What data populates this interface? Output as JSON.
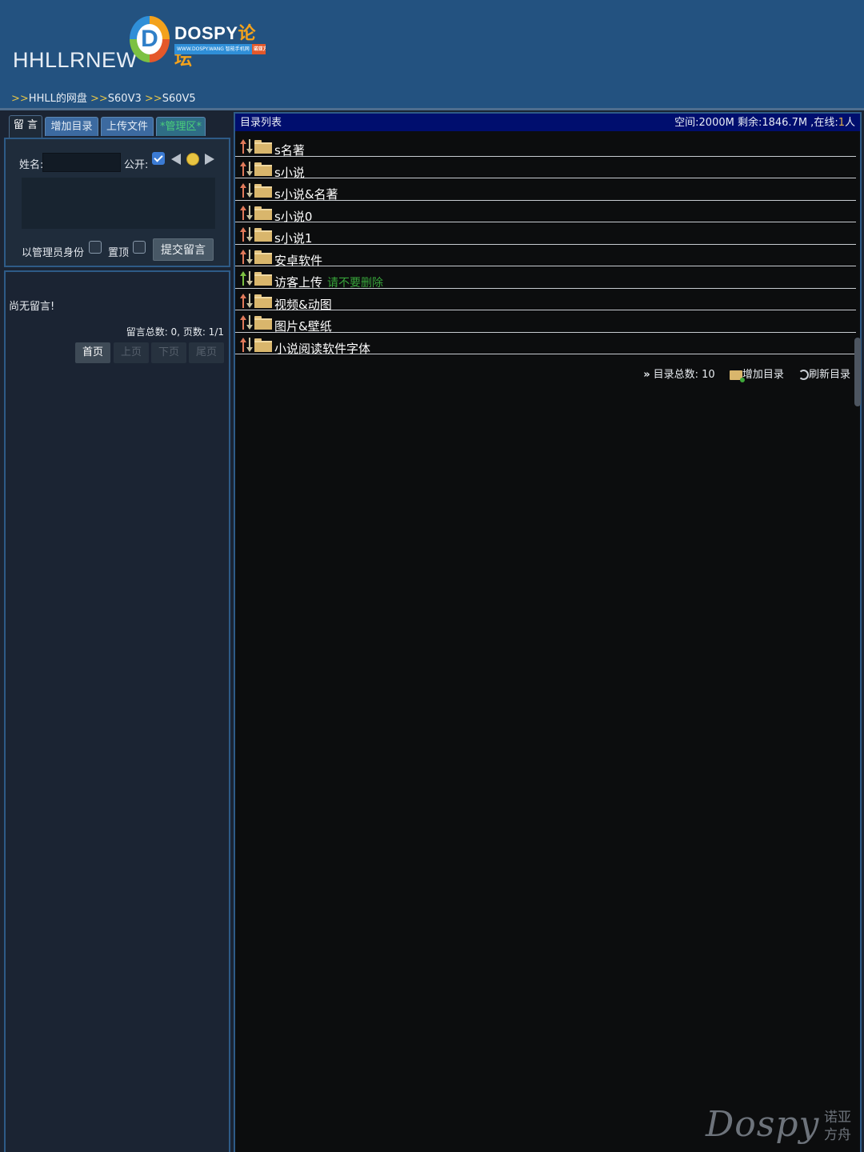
{
  "header": {
    "site_title": "HHLLRNEW",
    "logo": {
      "letter": "D",
      "name_white": "DOSPY",
      "name_orange": "论坛",
      "tagline": "WWW.DOSPY.WANG 智能手机网",
      "tagline_badge": "诺亚方舟"
    },
    "breadcrumb": [
      {
        "arrow": ">>",
        "label": "HHLL的网盘"
      },
      {
        "arrow": ">>",
        "label": "S60V3"
      },
      {
        "arrow": ">>",
        "label": "S60V5"
      }
    ]
  },
  "tabs": [
    {
      "label": "留 言",
      "active": true
    },
    {
      "label": "增加目录",
      "active": false
    },
    {
      "label": "上传文件",
      "active": false
    },
    {
      "label": "*管理区*",
      "active": false
    }
  ],
  "message_form": {
    "name_label": "姓名:",
    "name_value": "",
    "public_label": "公开:",
    "public_checked": true,
    "admin_label": "以管理员身份",
    "admin_checked": false,
    "pin_label": "置顶",
    "pin_checked": false,
    "submit_label": "提交留言"
  },
  "message_list": {
    "empty_text": "尚无留言!",
    "stats": "留言总数: 0, 页数: 1/1",
    "pager": [
      {
        "label": "首页",
        "enabled": true
      },
      {
        "label": "上页",
        "enabled": false
      },
      {
        "label": "下页",
        "enabled": false
      },
      {
        "label": "尾页",
        "enabled": false
      }
    ]
  },
  "directory": {
    "header_title": "目录列表",
    "space_text": "空间:2000M 剩余:1846.7M ,在线:",
    "online_count": "1",
    "online_unit": "人",
    "items": [
      {
        "name": "s名著",
        "note": ""
      },
      {
        "name": "s小说",
        "note": ""
      },
      {
        "name": "s小说&名著",
        "note": ""
      },
      {
        "name": "s小说0",
        "note": ""
      },
      {
        "name": "s小说1",
        "note": ""
      },
      {
        "name": "安卓软件",
        "note": ""
      },
      {
        "name": "访客上传",
        "note": "请不要删除"
      },
      {
        "name": "视频&动图",
        "note": ""
      },
      {
        "name": "图片&壁纸",
        "note": ""
      },
      {
        "name": "小说阅读软件字体",
        "note": ""
      }
    ],
    "footer": {
      "arrows": "»",
      "total_label": "目录总数: 10",
      "add_label": "增加目录",
      "refresh_label": "刷新目录"
    }
  },
  "watermark": {
    "main": "Dospy",
    "sub_line1": "诺亚",
    "sub_line2": "方舟"
  },
  "colors": {
    "header_bg": "#235280",
    "panel_bg": "#1b2433",
    "dir_header_bg": "#000e6e",
    "dir_bg": "#0c0d0e",
    "note_green": "#37a33a",
    "arrow_yellow": "#e3c44a",
    "folder": "#d9b66c"
  }
}
